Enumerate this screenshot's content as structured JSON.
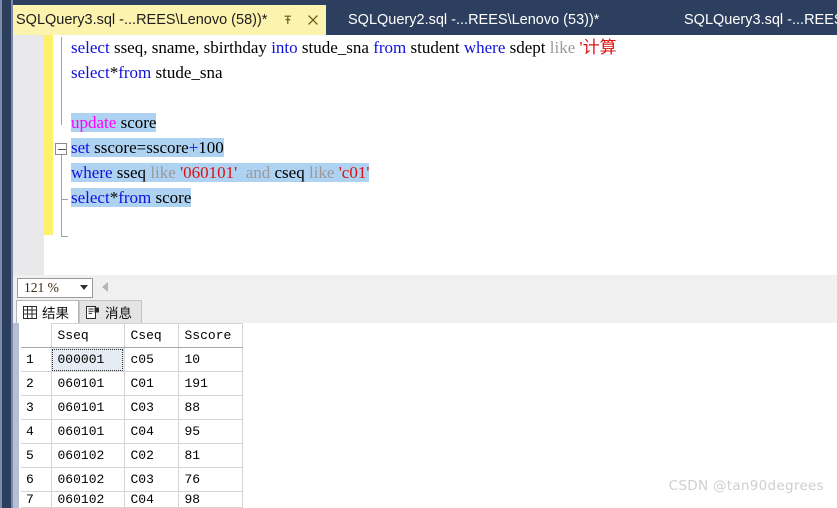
{
  "window": {
    "title": "Microsoft SQL Server Management Studio",
    "chrome_color": "#2d3f5f",
    "active_tab_color": "#fcf3ae",
    "selection_color": "#aed2f2",
    "change_bar_color": "#fdf06a"
  },
  "tabs": [
    {
      "label": "SQLQuery3.sql -...REES\\Lenovo (58))*",
      "active": true,
      "pin_icon": "pin-icon",
      "close_icon": "close-icon"
    },
    {
      "label": "SQLQuery2.sql -...REES\\Lenovo (53))*",
      "active": false
    },
    {
      "label": "SQLQuery3.sql -...REES",
      "active": false
    }
  ],
  "editor": {
    "lines": [
      {
        "segments": [
          {
            "text": "select",
            "style": "kw"
          },
          {
            "text": " sseq, sname, sbirthday ",
            "style": "plain"
          },
          {
            "text": "into",
            "style": "kw"
          },
          {
            "text": " stude_sna ",
            "style": "plain"
          },
          {
            "text": "from",
            "style": "kw"
          },
          {
            "text": " student ",
            "style": "plain"
          },
          {
            "text": "where",
            "style": "kw"
          },
          {
            "text": " sdept ",
            "style": "plain"
          },
          {
            "text": "like",
            "style": "gray"
          },
          {
            "text": " '计算",
            "style": "str"
          }
        ],
        "selected": false
      },
      {
        "segments": [
          {
            "text": "select",
            "style": "kw"
          },
          {
            "text": "*",
            "style": "plain"
          },
          {
            "text": "from",
            "style": "kw"
          },
          {
            "text": " stude_sna",
            "style": "plain"
          }
        ],
        "selected": false
      },
      {
        "segments": [],
        "selected": false
      },
      {
        "segments": [
          {
            "text": "update",
            "style": "kw-m"
          },
          {
            "text": " score",
            "style": "plain"
          }
        ],
        "selected": true
      },
      {
        "segments": [
          {
            "text": "set",
            "style": "kw"
          },
          {
            "text": " sscore=sscore",
            "style": "plain"
          },
          {
            "text": "+",
            "style": "kw"
          },
          {
            "text": "100",
            "style": "plain"
          }
        ],
        "selected": true
      },
      {
        "segments": [
          {
            "text": "where",
            "style": "kw"
          },
          {
            "text": " sseq ",
            "style": "plain"
          },
          {
            "text": "like",
            "style": "gray"
          },
          {
            "text": " '060101'",
            "style": "str"
          },
          {
            "text": "  and ",
            "style": "gray"
          },
          {
            "text": "cseq ",
            "style": "plain"
          },
          {
            "text": "like",
            "style": "gray"
          },
          {
            "text": " 'c01'",
            "style": "str"
          }
        ],
        "selected": true
      },
      {
        "segments": [
          {
            "text": "select",
            "style": "kw"
          },
          {
            "text": "*",
            "style": "plain"
          },
          {
            "text": "from",
            "style": "kw"
          },
          {
            "text": " score",
            "style": "plain"
          }
        ],
        "selected": true
      }
    ]
  },
  "zoom_toolbar": {
    "zoom_value": "121 %",
    "dropdown_icon": "chevron-down-icon",
    "scroll_left_icon": "triangle-left-icon"
  },
  "result_tabs": [
    {
      "label": "结果",
      "icon": "grid-icon",
      "active": true
    },
    {
      "label": "消息",
      "icon": "document-icon",
      "active": false
    }
  ],
  "results_grid": {
    "columns": [
      "Sseq",
      "Cseq",
      "Sscore"
    ],
    "rows": [
      {
        "num": "1",
        "Sseq": "000001",
        "Cseq": "c05",
        "Sscore": "10",
        "current": true
      },
      {
        "num": "2",
        "Sseq": "060101",
        "Cseq": "C01",
        "Sscore": "191",
        "current": false
      },
      {
        "num": "3",
        "Sseq": "060101",
        "Cseq": "C03",
        "Sscore": "88",
        "current": false
      },
      {
        "num": "4",
        "Sseq": "060101",
        "Cseq": "C04",
        "Sscore": "95",
        "current": false
      },
      {
        "num": "5",
        "Sseq": "060102",
        "Cseq": "C02",
        "Sscore": "81",
        "current": false
      },
      {
        "num": "6",
        "Sseq": "060102",
        "Cseq": "C03",
        "Sscore": "76",
        "current": false
      },
      {
        "num": "7",
        "Sseq": "060102",
        "Cseq": "C04",
        "Sscore": "98",
        "current": false,
        "clipped": true
      }
    ]
  },
  "watermark": {
    "text": "CSDN @tan90degrees"
  }
}
